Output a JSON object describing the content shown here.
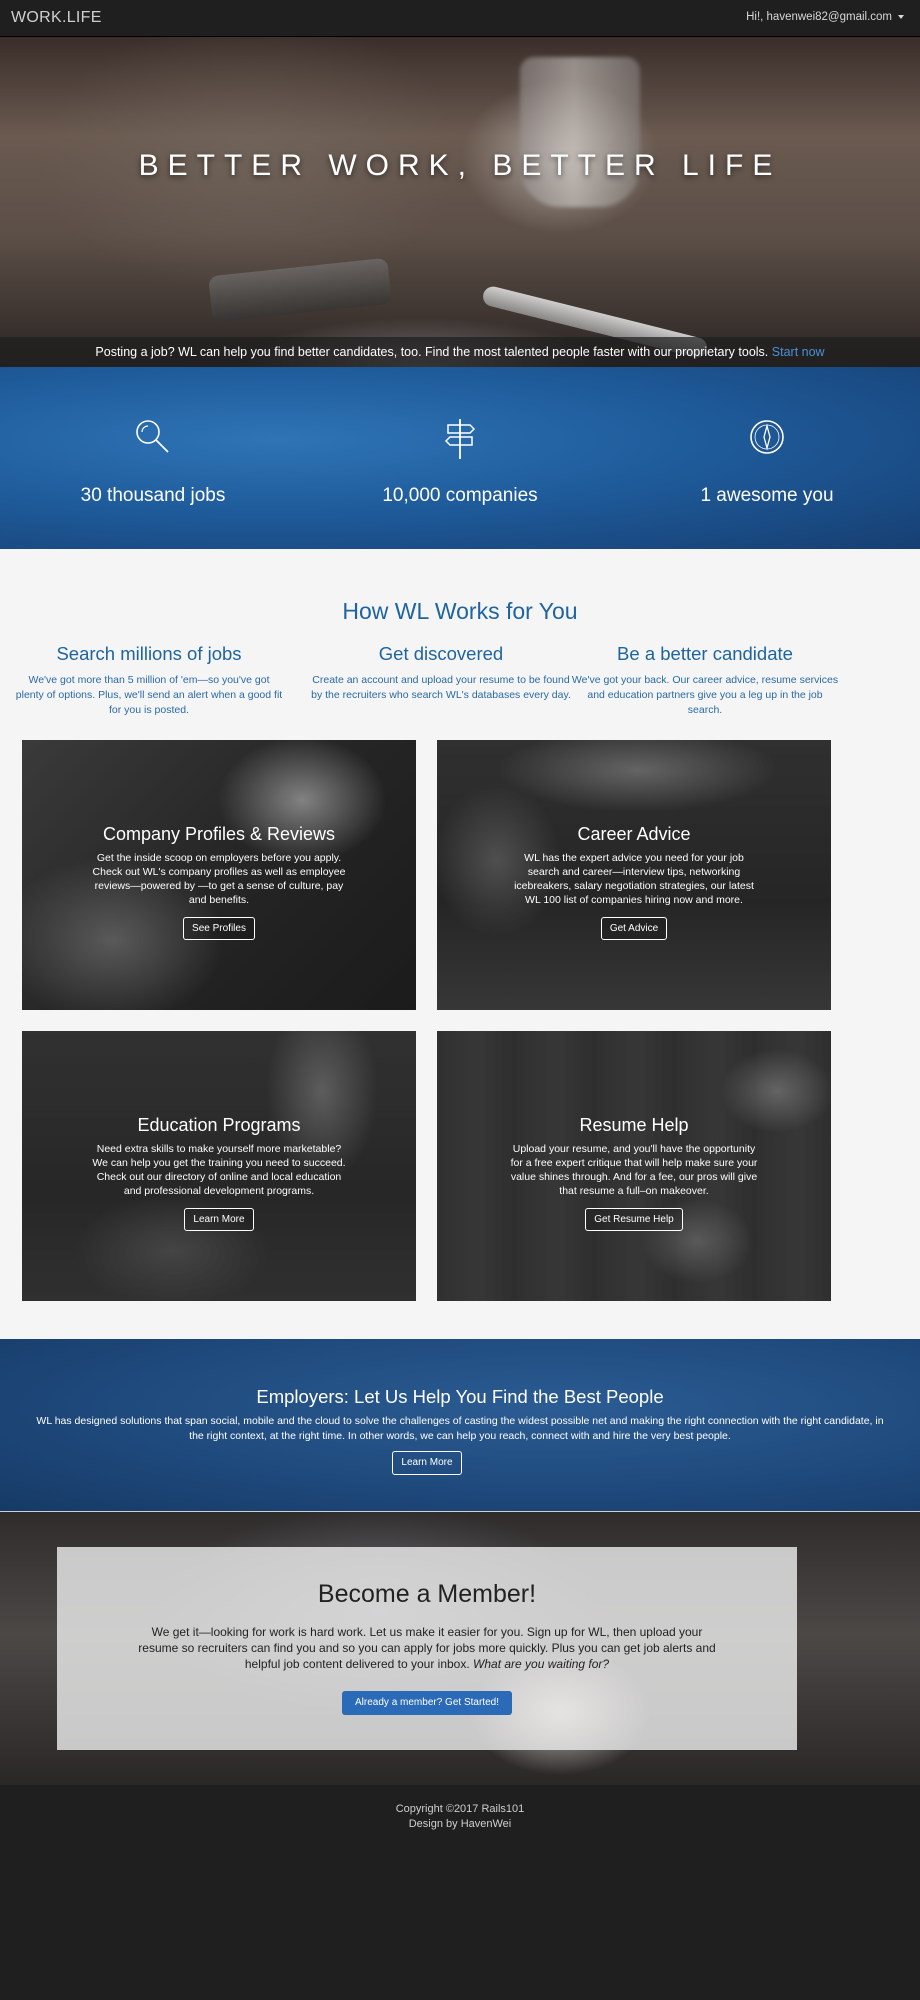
{
  "navbar": {
    "brand": "WORK.LIFE",
    "user_greeting": "Hi!, havenwei82@gmail.com"
  },
  "hero": {
    "title": "BETTER WORK, BETTER LIFE",
    "bar_text": "Posting a job? WL can help you find better candidates, too. Find the most talented people faster with our proprietary tools.",
    "bar_link": "Start now"
  },
  "stats": [
    {
      "icon": "magnifier-icon",
      "text": "30 thousand  jobs"
    },
    {
      "icon": "signpost-icon",
      "text": "10,000  companies"
    },
    {
      "icon": "compass-icon",
      "text": "1 awesome you"
    }
  ],
  "how": {
    "title": "How WL Works for You",
    "features": [
      {
        "title": "Search millions of jobs",
        "text": "We've got more than 5 million of 'em—so you've got plenty of options. Plus, we'll send an alert when a good fit for you is posted."
      },
      {
        "title": "Get discovered",
        "text": "Create an account and upload your resume to be found by the recruiters who search WL's databases every day."
      },
      {
        "title": "Be a better candidate",
        "text": "We've got your back. Our career advice, resume services and education partners give you a leg up in the job search."
      }
    ]
  },
  "cards": [
    {
      "title": "Company Profiles & Reviews",
      "text": "Get the inside scoop on employers before you apply. Check out WL's company profiles as well as employee reviews—powered by —to get a sense of culture, pay and benefits.",
      "button": "See Profiles"
    },
    {
      "title": "Career Advice",
      "text": "WL has the expert advice you need for your job search and career—interview tips, networking icebreakers, salary negotiation strategies, our latest WL 100 list of companies hiring now and more.",
      "button": "Get Advice"
    },
    {
      "title": "Education Programs",
      "text": "Need extra skills to make yourself more marketable? We can help you get the training you need to succeed. Check out our directory of online and local education and professional development programs.",
      "button": "Learn More"
    },
    {
      "title": "Resume Help",
      "text": "Upload your resume, and you'll have the opportunity for a free expert critique that will help make sure your value shines through. And for a fee, our pros will give that resume a full–on makeover.",
      "button": "Get Resume Help"
    }
  ],
  "employers": {
    "title": "Employers: Let Us Help You Find the Best People",
    "text": "WL has designed solutions that span social, mobile and the cloud to solve the challenges of casting the widest possible net and making the right connection with the right candidate, in the right context, at the right time. In other words, we can help you reach, connect with and hire the very best people.",
    "button": "Learn More"
  },
  "member": {
    "title": "Become a Member!",
    "text": "We get it—looking for work is hard work. Let us make it easier for you. Sign up for WL, then upload your resume so recruiters can find you and so you can apply for jobs more quickly. Plus you can get job alerts and helpful job content delivered to your inbox.",
    "text_emphasis": "What are you waiting for?",
    "cta": "Already a member? Get Started!"
  },
  "footer": {
    "copyright": "Copyright ©2017 Rails101",
    "credit": "Design by HavenWei"
  }
}
